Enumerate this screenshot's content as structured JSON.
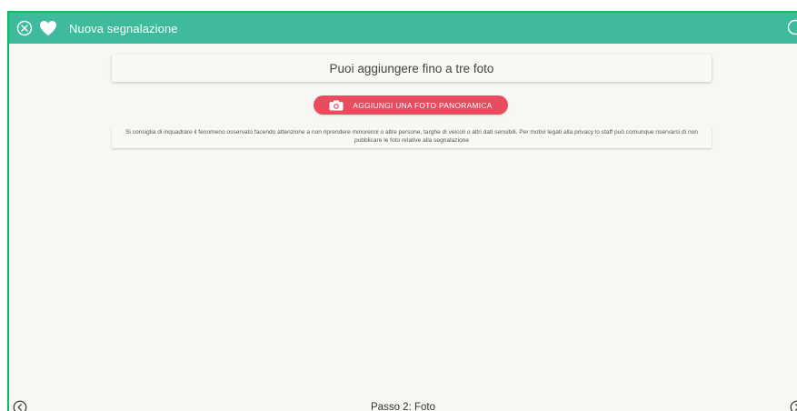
{
  "header": {
    "title": "Nuova segnalazione",
    "close_icon": "circle-x-icon",
    "favorite_icon": "heart-icon",
    "right_icon": "circle-icon-partial",
    "background_color": "#3dbb9c"
  },
  "main": {
    "info_text": "Puoi aggiungere fino a tre foto",
    "add_photo_button": {
      "label": "AGGIUNGI UNA FOTO PANORAMICA",
      "icon": "camera-icon",
      "color": "#e94b5f"
    },
    "disclaimer": "Si consiglia di inquadrare il fenomeno osservato facendo attenzione a non riprendere minorenni o altre persone, targhe di veicoli o altri dati sensibili. Per motivi legati alla privacy lo staff può comunque riservarsi di non pubblicare le foto relative alla segnalazione"
  },
  "footer": {
    "step_label": "Passo 2: Foto",
    "prev_icon": "chevron-left-circle-icon",
    "next_icon": "chevron-right-circle-icon"
  },
  "colors": {
    "frame_border": "#00c15a",
    "page_background": "#f8f7f3"
  }
}
